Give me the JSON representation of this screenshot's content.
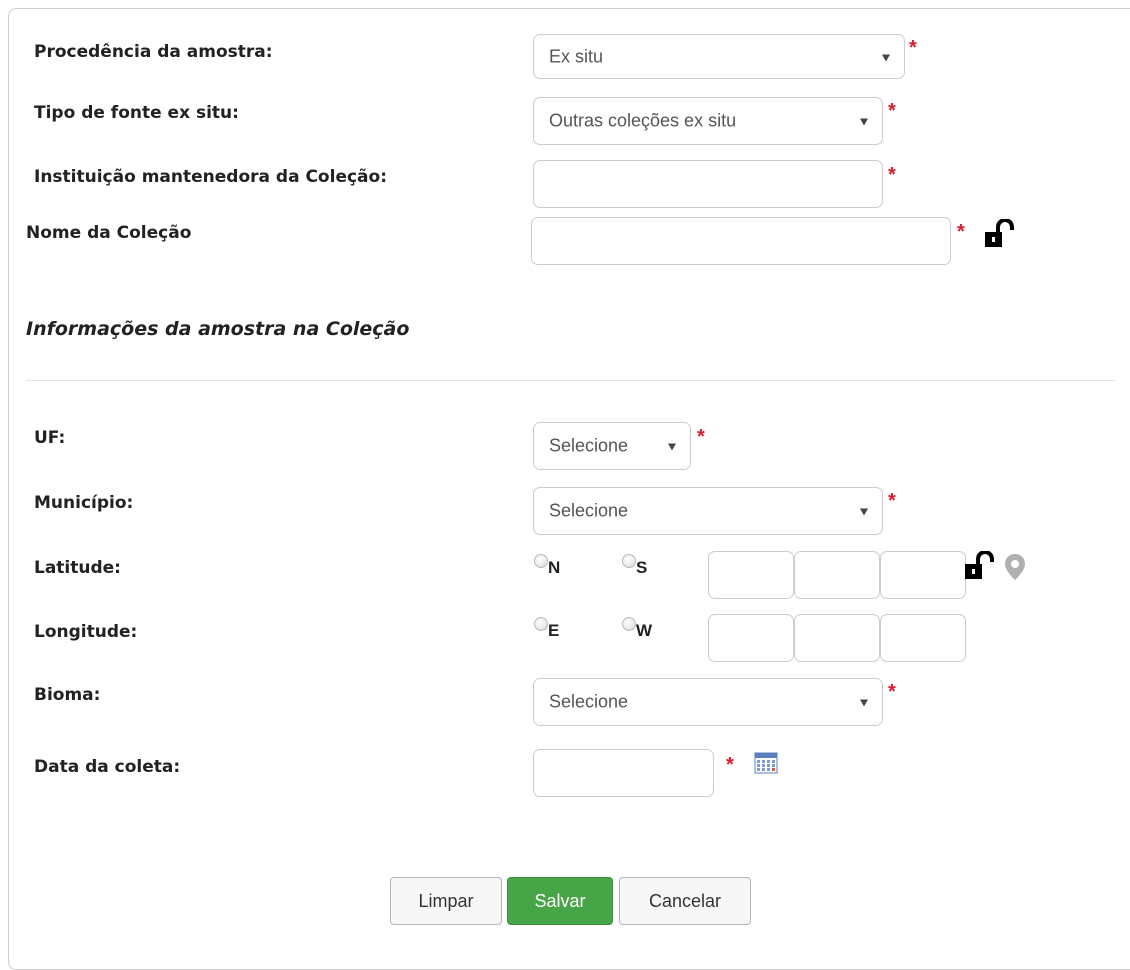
{
  "form": {
    "procedencia": {
      "label": "Procedência da amostra:",
      "value": "Ex situ"
    },
    "tipo_fonte": {
      "label": "Tipo de fonte ex situ:",
      "value": "Outras coleções ex situ"
    },
    "instituicao": {
      "label": "Instituição mantenedora da Coleção:",
      "value": ""
    },
    "nome_colecao": {
      "label": "Nome da Coleção",
      "value": ""
    },
    "required_mark": "*"
  },
  "section": {
    "title": "Informações da amostra na Coleção"
  },
  "amostra": {
    "uf": {
      "label": "UF:",
      "value": "Selecione"
    },
    "municipio": {
      "label": "Município:",
      "value": "Selecione"
    },
    "latitude": {
      "label": "Latitude:",
      "options": [
        "N",
        "S"
      ],
      "deg": "",
      "min": "",
      "sec": ""
    },
    "longitude": {
      "label": "Longitude:",
      "options": [
        "E",
        "W"
      ],
      "deg": "",
      "min": "",
      "sec": ""
    },
    "bioma": {
      "label": "Bioma:",
      "value": "Selecione"
    },
    "data_coleta": {
      "label": "Data da coleta:",
      "value": ""
    }
  },
  "buttons": {
    "limpar": "Limpar",
    "salvar": "Salvar",
    "cancelar": "Cancelar"
  },
  "icons": {
    "lock": "unlock-icon",
    "map": "map-pin-icon",
    "calendar": "calendar-icon"
  },
  "colors": {
    "required": "#e0182a",
    "primary_button": "#47a447"
  }
}
